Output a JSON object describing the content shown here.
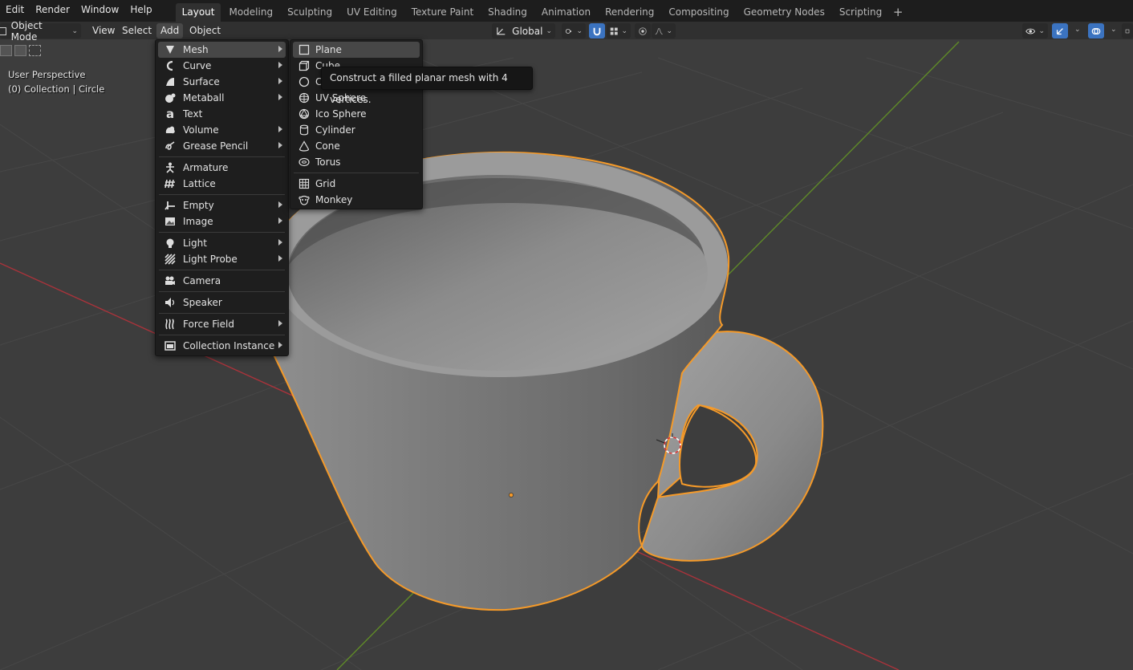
{
  "menubar": {
    "items": [
      "Edit",
      "Render",
      "Window",
      "Help"
    ]
  },
  "workspaces": {
    "tabs": [
      "Layout",
      "Modeling",
      "Sculpting",
      "UV Editing",
      "Texture Paint",
      "Shading",
      "Animation",
      "Rendering",
      "Compositing",
      "Geometry Nodes",
      "Scripting"
    ],
    "active": "Layout",
    "add_label": "+"
  },
  "viewport_header": {
    "mode": "Object Mode",
    "view": "View",
    "select": "Select",
    "add": "Add",
    "object": "Object",
    "orientation": "Global"
  },
  "viewport": {
    "perspective_label": "User Perspective",
    "collection_label": "(0) Collection | Circle"
  },
  "add_menu": {
    "items": [
      {
        "label": "Mesh",
        "icon": "mesh-icon",
        "submenu": true
      },
      {
        "label": "Curve",
        "icon": "curve-icon",
        "submenu": true
      },
      {
        "label": "Surface",
        "icon": "surface-icon",
        "submenu": true
      },
      {
        "label": "Metaball",
        "icon": "metaball-icon",
        "submenu": true
      },
      {
        "label": "Text",
        "icon": "text-icon",
        "submenu": false
      },
      {
        "label": "Volume",
        "icon": "volume-icon",
        "submenu": true
      },
      {
        "label": "Grease Pencil",
        "icon": "grease-pencil-icon",
        "submenu": true
      },
      {
        "label": "Armature",
        "icon": "armature-icon",
        "submenu": false
      },
      {
        "label": "Lattice",
        "icon": "lattice-icon",
        "submenu": false
      },
      {
        "label": "Empty",
        "icon": "empty-icon",
        "submenu": true
      },
      {
        "label": "Image",
        "icon": "image-icon",
        "submenu": true
      },
      {
        "label": "Light",
        "icon": "light-icon",
        "submenu": true
      },
      {
        "label": "Light Probe",
        "icon": "light-probe-icon",
        "submenu": true
      },
      {
        "label": "Camera",
        "icon": "camera-icon",
        "submenu": false
      },
      {
        "label": "Speaker",
        "icon": "speaker-icon",
        "submenu": false
      },
      {
        "label": "Force Field",
        "icon": "force-field-icon",
        "submenu": true
      },
      {
        "label": "Collection Instance",
        "icon": "collection-instance-icon",
        "submenu": true
      }
    ]
  },
  "mesh_menu": {
    "items": [
      {
        "label": "Plane",
        "icon": "plane-icon"
      },
      {
        "label": "Cube",
        "icon": "cube-icon"
      },
      {
        "label": "Circle",
        "icon": "circle-icon"
      },
      {
        "label": "UV Sphere",
        "icon": "uv-sphere-icon"
      },
      {
        "label": "Ico Sphere",
        "icon": "ico-sphere-icon"
      },
      {
        "label": "Cylinder",
        "icon": "cylinder-icon"
      },
      {
        "label": "Cone",
        "icon": "cone-icon"
      },
      {
        "label": "Torus",
        "icon": "torus-icon"
      },
      {
        "label": "Grid",
        "icon": "grid-icon"
      },
      {
        "label": "Monkey",
        "icon": "monkey-icon"
      }
    ]
  },
  "tooltip": {
    "text": "Construct a filled planar mesh with 4 vertices."
  },
  "colors": {
    "selection_outline": "#f59a29",
    "x_axis": "#c0353f",
    "y_axis": "#6a9a2c",
    "menu_bg": "#1e1e1e",
    "hover_bg": "#474747"
  }
}
